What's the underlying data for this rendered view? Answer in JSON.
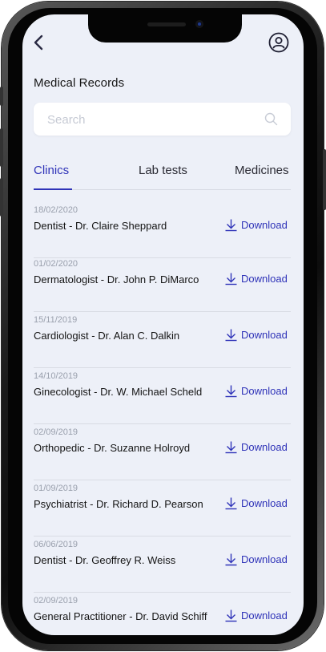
{
  "header": {
    "title": "Medical Records"
  },
  "search": {
    "placeholder": "Search"
  },
  "tabs": [
    {
      "label": "Clinics",
      "active": true
    },
    {
      "label": "Lab tests",
      "active": false
    },
    {
      "label": "Medicines",
      "active": false
    }
  ],
  "download_label": "Download",
  "records": [
    {
      "date": "18/02/2020",
      "name": "Dentist - Dr. Claire Sheppard"
    },
    {
      "date": "01/02/2020",
      "name": "Dermatologist - Dr. John P. DiMarco"
    },
    {
      "date": "15/11/2019",
      "name": "Cardiologist - Dr. Alan C. Dalkin"
    },
    {
      "date": "14/10/2019",
      "name": "Ginecologist - Dr. W. Michael Scheld"
    },
    {
      "date": "02/09/2019",
      "name": "Orthopedic - Dr. Suzanne Holroyd"
    },
    {
      "date": "01/09/2019",
      "name": "Psychiatrist - Dr. Richard D. Pearson"
    },
    {
      "date": "06/06/2019",
      "name": "Dentist - Dr. Geoffrey R. Weiss"
    },
    {
      "date": "02/09/2019",
      "name": "General Practitioner - Dr. David Schiff"
    }
  ],
  "icons": {
    "back": "chevron-left-icon",
    "profile": "user-circle-icon",
    "search": "search-icon",
    "download": "download-icon"
  },
  "colors": {
    "accent": "#2f33b8",
    "background": "#edf0f8",
    "date_text": "#9aa0ad"
  }
}
